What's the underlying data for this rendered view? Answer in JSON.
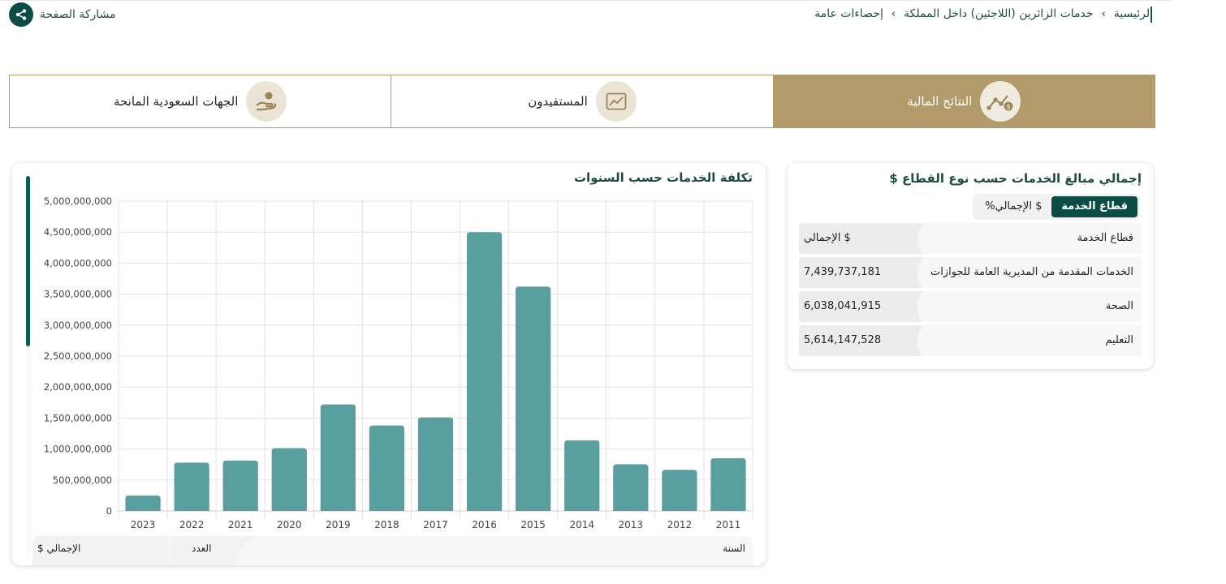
{
  "breadcrumb": {
    "home": "الرئيسية",
    "section": "خدمات الزائرين (اللاجئين) داخل المملكة",
    "current": "إحصاءات عامة",
    "separator_icon": "chevron-left-icon"
  },
  "share": {
    "label": "مشاركة الصفحة",
    "icon": "share-icon"
  },
  "tabs": [
    {
      "label": "النتائج المالية",
      "icon": "financial-trend-icon",
      "active": true
    },
    {
      "label": "المستفيدون",
      "icon": "line-chart-icon",
      "active": false
    },
    {
      "label": "الجهات السعودية المانحة",
      "icon": "donation-hand-icon",
      "active": false
    }
  ],
  "sector_card": {
    "title": "إجمالي مبالغ الخدمات حسب نوع القطاع $",
    "toggle": {
      "option_sector": "قطاع الخدمة",
      "option_total": "%الإجمالي $"
    },
    "header": {
      "label": "قطاع الخدمة",
      "value": "الإجمالي $"
    },
    "rows": [
      {
        "label": "الخدمات المقدمة من المديرية العامة للجوازات",
        "value": "7,439,737,181"
      },
      {
        "label": "الصحة",
        "value": "6,038,041,915"
      },
      {
        "label": "التعليم",
        "value": "5,614,147,528"
      }
    ]
  },
  "years_card": {
    "title": "تكلفة الخدمات حسب السنوات",
    "table_header": {
      "year": "السنة",
      "count": "العدد",
      "total": "الإجمالي $"
    }
  },
  "colors": {
    "accent": "#0b4d45",
    "gold": "#b39a6a",
    "bar": "#5a9f9f"
  },
  "chart_data": {
    "type": "bar",
    "categories": [
      "2023",
      "2022",
      "2021",
      "2020",
      "2019",
      "2018",
      "2017",
      "2016",
      "2015",
      "2014",
      "2013",
      "2012",
      "2011"
    ],
    "values": [
      250000000,
      780000000,
      815000000,
      1015000000,
      1720000000,
      1380000000,
      1510000000,
      4500000000,
      3620000000,
      1140000000,
      755000000,
      665000000,
      850000000
    ],
    "ylim": [
      0,
      5000000000
    ],
    "yticks": [
      "0",
      "500,000,000",
      "1,000,000,000",
      "1,500,000,000",
      "2,000,000,000",
      "2,500,000,000",
      "3,000,000,000",
      "3,500,000,000",
      "4,000,000,000",
      "4,500,000,000",
      "5,000,000,000"
    ],
    "grid": true
  }
}
